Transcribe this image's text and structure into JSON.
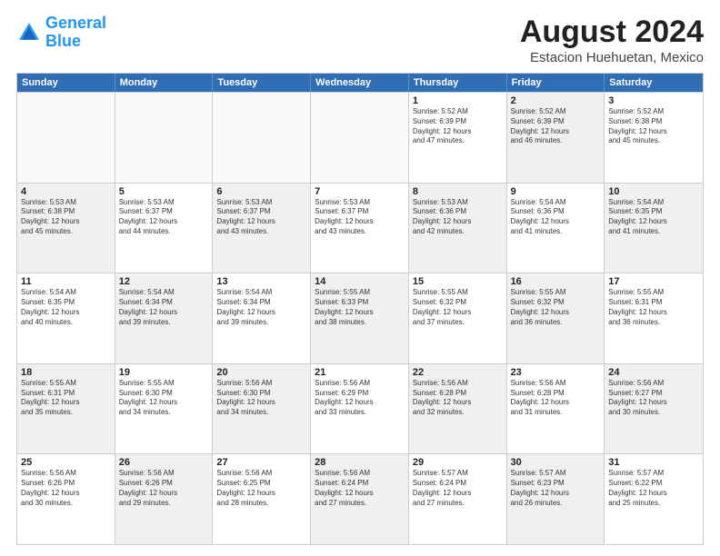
{
  "logo": {
    "line1": "General",
    "line2": "Blue"
  },
  "title": "August 2024",
  "subtitle": "Estacion Huehuetan, Mexico",
  "header_days": [
    "Sunday",
    "Monday",
    "Tuesday",
    "Wednesday",
    "Thursday",
    "Friday",
    "Saturday"
  ],
  "rows": [
    [
      {
        "num": "",
        "text": "",
        "empty": true
      },
      {
        "num": "",
        "text": "",
        "empty": true
      },
      {
        "num": "",
        "text": "",
        "empty": true
      },
      {
        "num": "",
        "text": "",
        "empty": true
      },
      {
        "num": "1",
        "text": "Sunrise: 5:52 AM\nSunset: 6:39 PM\nDaylight: 12 hours\nand 47 minutes.",
        "shaded": false
      },
      {
        "num": "2",
        "text": "Sunrise: 5:52 AM\nSunset: 6:39 PM\nDaylight: 12 hours\nand 46 minutes.",
        "shaded": true
      },
      {
        "num": "3",
        "text": "Sunrise: 5:52 AM\nSunset: 6:38 PM\nDaylight: 12 hours\nand 45 minutes.",
        "shaded": false
      }
    ],
    [
      {
        "num": "4",
        "text": "Sunrise: 5:53 AM\nSunset: 6:38 PM\nDaylight: 12 hours\nand 45 minutes.",
        "shaded": true
      },
      {
        "num": "5",
        "text": "Sunrise: 5:53 AM\nSunset: 6:37 PM\nDaylight: 12 hours\nand 44 minutes.",
        "shaded": false
      },
      {
        "num": "6",
        "text": "Sunrise: 5:53 AM\nSunset: 6:37 PM\nDaylight: 12 hours\nand 43 minutes.",
        "shaded": true
      },
      {
        "num": "7",
        "text": "Sunrise: 5:53 AM\nSunset: 6:37 PM\nDaylight: 12 hours\nand 43 minutes.",
        "shaded": false
      },
      {
        "num": "8",
        "text": "Sunrise: 5:53 AM\nSunset: 6:36 PM\nDaylight: 12 hours\nand 42 minutes.",
        "shaded": true
      },
      {
        "num": "9",
        "text": "Sunrise: 5:54 AM\nSunset: 6:36 PM\nDaylight: 12 hours\nand 41 minutes.",
        "shaded": false
      },
      {
        "num": "10",
        "text": "Sunrise: 5:54 AM\nSunset: 6:35 PM\nDaylight: 12 hours\nand 41 minutes.",
        "shaded": true
      }
    ],
    [
      {
        "num": "11",
        "text": "Sunrise: 5:54 AM\nSunset: 6:35 PM\nDaylight: 12 hours\nand 40 minutes.",
        "shaded": false
      },
      {
        "num": "12",
        "text": "Sunrise: 5:54 AM\nSunset: 6:34 PM\nDaylight: 12 hours\nand 39 minutes.",
        "shaded": true
      },
      {
        "num": "13",
        "text": "Sunrise: 5:54 AM\nSunset: 6:34 PM\nDaylight: 12 hours\nand 39 minutes.",
        "shaded": false
      },
      {
        "num": "14",
        "text": "Sunrise: 5:55 AM\nSunset: 6:33 PM\nDaylight: 12 hours\nand 38 minutes.",
        "shaded": true
      },
      {
        "num": "15",
        "text": "Sunrise: 5:55 AM\nSunset: 6:32 PM\nDaylight: 12 hours\nand 37 minutes.",
        "shaded": false
      },
      {
        "num": "16",
        "text": "Sunrise: 5:55 AM\nSunset: 6:32 PM\nDaylight: 12 hours\nand 36 minutes.",
        "shaded": true
      },
      {
        "num": "17",
        "text": "Sunrise: 5:55 AM\nSunset: 6:31 PM\nDaylight: 12 hours\nand 36 minutes.",
        "shaded": false
      }
    ],
    [
      {
        "num": "18",
        "text": "Sunrise: 5:55 AM\nSunset: 6:31 PM\nDaylight: 12 hours\nand 35 minutes.",
        "shaded": true
      },
      {
        "num": "19",
        "text": "Sunrise: 5:55 AM\nSunset: 6:30 PM\nDaylight: 12 hours\nand 34 minutes.",
        "shaded": false
      },
      {
        "num": "20",
        "text": "Sunrise: 5:56 AM\nSunset: 6:30 PM\nDaylight: 12 hours\nand 34 minutes.",
        "shaded": true
      },
      {
        "num": "21",
        "text": "Sunrise: 5:56 AM\nSunset: 6:29 PM\nDaylight: 12 hours\nand 33 minutes.",
        "shaded": false
      },
      {
        "num": "22",
        "text": "Sunrise: 5:56 AM\nSunset: 6:28 PM\nDaylight: 12 hours\nand 32 minutes.",
        "shaded": true
      },
      {
        "num": "23",
        "text": "Sunrise: 5:56 AM\nSunset: 6:28 PM\nDaylight: 12 hours\nand 31 minutes.",
        "shaded": false
      },
      {
        "num": "24",
        "text": "Sunrise: 5:56 AM\nSunset: 6:27 PM\nDaylight: 12 hours\nand 30 minutes.",
        "shaded": true
      }
    ],
    [
      {
        "num": "25",
        "text": "Sunrise: 5:56 AM\nSunset: 6:26 PM\nDaylight: 12 hours\nand 30 minutes.",
        "shaded": false
      },
      {
        "num": "26",
        "text": "Sunrise: 5:56 AM\nSunset: 6:26 PM\nDaylight: 12 hours\nand 29 minutes.",
        "shaded": true
      },
      {
        "num": "27",
        "text": "Sunrise: 5:56 AM\nSunset: 6:25 PM\nDaylight: 12 hours\nand 28 minutes.",
        "shaded": false
      },
      {
        "num": "28",
        "text": "Sunrise: 5:56 AM\nSunset: 6:24 PM\nDaylight: 12 hours\nand 27 minutes.",
        "shaded": true
      },
      {
        "num": "29",
        "text": "Sunrise: 5:57 AM\nSunset: 6:24 PM\nDaylight: 12 hours\nand 27 minutes.",
        "shaded": false
      },
      {
        "num": "30",
        "text": "Sunrise: 5:57 AM\nSunset: 6:23 PM\nDaylight: 12 hours\nand 26 minutes.",
        "shaded": true
      },
      {
        "num": "31",
        "text": "Sunrise: 5:57 AM\nSunset: 6:22 PM\nDaylight: 12 hours\nand 25 minutes.",
        "shaded": false
      }
    ]
  ]
}
